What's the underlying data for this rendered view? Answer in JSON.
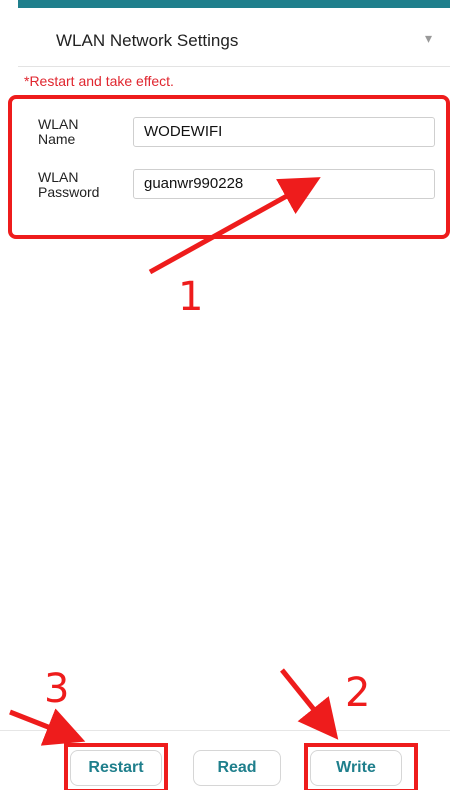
{
  "header": {
    "title": "WLAN Network Settings",
    "chevron_icon": "chevron-down-icon"
  },
  "notice": "*Restart and take effect.",
  "form": {
    "name_label": "WLAN\nName",
    "name_value": "WODEWIFI",
    "password_label": "WLAN\nPassword",
    "password_value": "guanwr990228"
  },
  "buttons": {
    "restart": "Restart",
    "read": "Read",
    "write": "Write"
  },
  "annotations": {
    "step1": "1",
    "step2": "2",
    "step3": "3"
  },
  "colors": {
    "accent": "#1f7f8c",
    "annotation": "#ee1c1c",
    "notice": "#e0262f"
  }
}
